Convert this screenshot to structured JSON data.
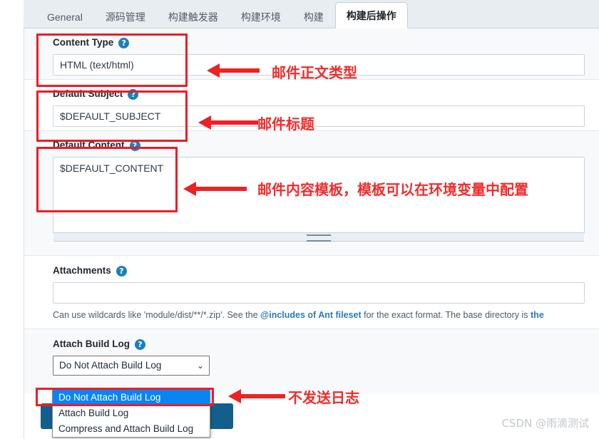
{
  "tabs": [
    {
      "label": "General",
      "active": false
    },
    {
      "label": "源码管理",
      "active": false
    },
    {
      "label": "构建触发器",
      "active": false
    },
    {
      "label": "构建环境",
      "active": false
    },
    {
      "label": "构建",
      "active": false
    },
    {
      "label": "构建后操作",
      "active": true
    }
  ],
  "help_badge_glyph": "?",
  "fields": {
    "content_type": {
      "label": "Content Type",
      "value": "HTML (text/html)"
    },
    "default_subject": {
      "label": "Default Subject",
      "value": "$DEFAULT_SUBJECT"
    },
    "default_content": {
      "label": "Default Content",
      "value": "$DEFAULT_CONTENT"
    },
    "attachments": {
      "label": "Attachments",
      "value": "",
      "help_prefix": "Can use wildcards like 'module/dist/**/*.zip'. See the ",
      "help_link": "@includes of Ant fileset",
      "help_middle": " for the exact format. The base directory is ",
      "help_link2": "the"
    },
    "attach_build_log": {
      "label": "Attach Build Log",
      "selected": "Do Not Attach Build Log",
      "chevron": "⌄",
      "options": [
        "Do Not Attach Build Log",
        "Attach Build Log",
        "Compress and Attach Build Log"
      ]
    }
  },
  "annotations": {
    "accent_color": "#ed1c24",
    "items": [
      {
        "text": "邮件正文类型"
      },
      {
        "text": "邮件标题"
      },
      {
        "text": "邮件内容模板，模板可以在环境变量中配置"
      },
      {
        "text": "不发送日志"
      }
    ]
  },
  "watermark": "CSDN @雨滴测试"
}
